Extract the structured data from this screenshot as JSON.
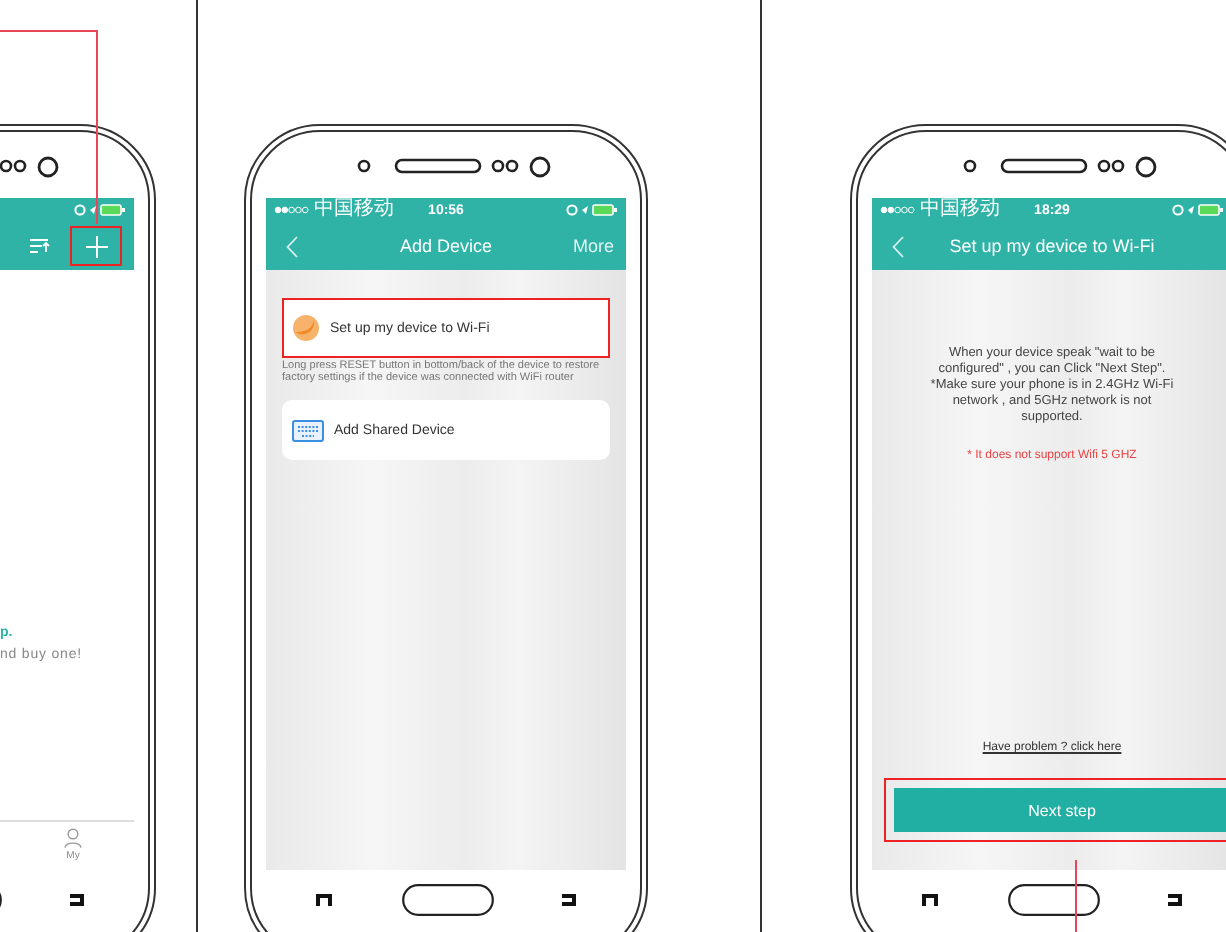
{
  "phones": [
    {
      "kind": "home",
      "add_button_highlighted": true,
      "texts": [
        "p.",
        "nd buy one!"
      ],
      "tab_label": "My"
    },
    {
      "kind": "add_device",
      "carrier": "中国移动",
      "time": "10:56",
      "title": "Add Device",
      "action": "More",
      "options": [
        {
          "kind": "wifi",
          "label": "Set up my device to Wi-Fi",
          "highlighted": true,
          "hint": "Long press RESET button in bottom/back of the device to restore factory settings if the device was connected with WiFi router"
        },
        {
          "kind": "shared",
          "label": "Add Shared Device",
          "highlighted": false
        }
      ]
    },
    {
      "kind": "wifi_setup",
      "carrier": "中国移动",
      "time": "18:29",
      "title": "Set up my device to Wi-Fi",
      "message": "When your device speak \"wait to be configured\" , you can Click \"Next Step\". *Make sure your phone is in 2.4GHz Wi-Fi network , and 5GHz network is not supported.",
      "warning": "* It does not support Wifi 5 GHZ",
      "help_link": "Have problem ? click here",
      "button": "Next step",
      "button_highlighted": true
    }
  ]
}
